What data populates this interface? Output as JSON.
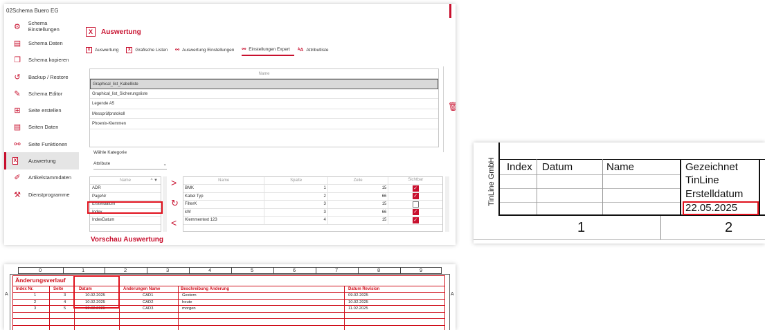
{
  "app": {
    "title": "02Schema Buero EG",
    "sidebar": [
      {
        "label": "Schema Einstellungen",
        "icon": "gear-icon",
        "glyph": "⚙"
      },
      {
        "label": "Schema Daten",
        "icon": "clipboard-icon",
        "glyph": "▤"
      },
      {
        "label": "Schema kopieren",
        "icon": "copy-icon",
        "glyph": "❐"
      },
      {
        "label": "Backup / Restore",
        "icon": "restore-icon",
        "glyph": "↺"
      },
      {
        "label": "Schema Editor",
        "icon": "pencil-icon",
        "glyph": "✎"
      },
      {
        "label": "Seite erstellen",
        "icon": "add-page-icon",
        "glyph": "⊞"
      },
      {
        "label": "Seiten Daten",
        "icon": "page-data-icon",
        "glyph": "▤"
      },
      {
        "label": "Seite Funktionen",
        "icon": "functions-icon",
        "glyph": "⚯"
      },
      {
        "label": "Auswertung",
        "icon": "excel-icon",
        "glyph": "X"
      },
      {
        "label": "Artikelstammdaten",
        "icon": "article-icon",
        "glyph": "✐"
      },
      {
        "label": "Dienstprogramme",
        "icon": "tools-icon",
        "glyph": "⚒"
      }
    ],
    "heading": "Auswertung",
    "tabs": [
      {
        "label": "Auswertung",
        "icon": "excel-icon",
        "glyph": "X"
      },
      {
        "label": "Grafische Listen",
        "icon": "excel-icon",
        "glyph": "X"
      },
      {
        "label": "Auswertung Einstellungen",
        "icon": "settings-icon",
        "glyph": "⚯"
      },
      {
        "label": "Einstellungen Expert",
        "icon": "settings-icon",
        "glyph": "⚯"
      },
      {
        "label": "Attributliste",
        "icon": "attribute-icon",
        "glyph": "ᴬA"
      }
    ],
    "name_header": "Name",
    "names": [
      "Graphical_list_Kabelliste",
      "Graphical_list_Sicherungsliste",
      "Legende A5",
      "Messprüfprotokoll",
      "Phoenix-Klemmen"
    ],
    "kategorie_label": "Wähle Kategorie",
    "kategorie_value": "Attribute",
    "left_header": "Name",
    "left_items": [
      "ADR",
      "PageNr",
      "Erstelldatum",
      "Index",
      "IndexDatum"
    ],
    "right_headers": {
      "name": "Name",
      "spalte": "Spalte",
      "zeile": "Zeile",
      "sichtbar": "Sichtbar"
    },
    "right_rows": [
      {
        "name": "BMK",
        "spalte": "1",
        "zeile": "15",
        "sichtbar": true
      },
      {
        "name": "Kabel Typ",
        "spalte": "2",
        "zeile": "66",
        "sichtbar": true
      },
      {
        "name": "FilterK",
        "spalte": "3",
        "zeile": "15",
        "sichtbar": false
      },
      {
        "name": "kW",
        "spalte": "3",
        "zeile": "66",
        "sichtbar": true
      },
      {
        "name": "Klemmentext 123",
        "spalte": "4",
        "zeile": "15",
        "sichtbar": true
      }
    ],
    "preview_label": "Vorschau Auswertung"
  },
  "titleblock": {
    "company": "TinLine GmbH",
    "headers": [
      "Index",
      "Datum",
      "Name",
      "Gezeichnet"
    ],
    "right_values": [
      "TinLine",
      "Erstelldatum",
      "22.05.2025"
    ],
    "columns": [
      "1",
      "2"
    ]
  },
  "history": {
    "ruler": [
      "0",
      "1",
      "2",
      "3",
      "4",
      "5",
      "6",
      "7",
      "8",
      "9"
    ],
    "title": "Änderungsverlauf",
    "side_letter": "A",
    "headers": [
      "Index Nr.",
      "Seite",
      "Datum",
      "Änderungen Name",
      "Beschreibung Änderung",
      "Datum Revision"
    ],
    "rows": [
      [
        "1",
        "3",
        "10.02.2025",
        "CAD1",
        "Gestern",
        "09.02.2025"
      ],
      [
        "2",
        "4",
        "10.02.2025",
        "CAD2",
        "heute",
        "10.02.2025"
      ],
      [
        "3",
        "5",
        "10.02.2025",
        "CAD3",
        "morgen",
        "11.02.2025"
      ]
    ]
  },
  "colors": {
    "accent": "#c8102e",
    "highlight": "#e0101c"
  }
}
